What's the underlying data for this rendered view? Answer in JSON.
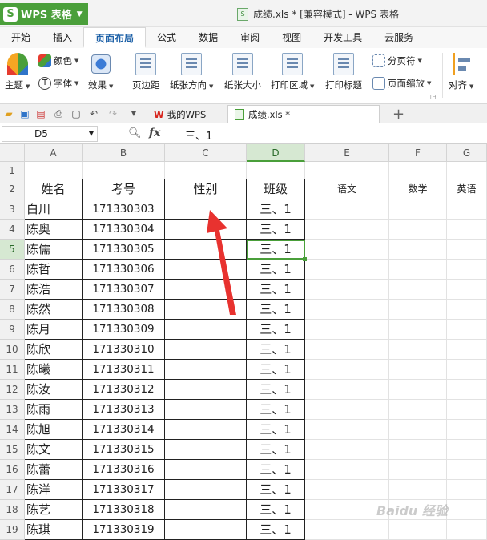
{
  "app": {
    "name": "WPS 表格",
    "logo_glyph": "S",
    "accent": "#4a9f3a"
  },
  "window": {
    "title": "成绩.xls * [兼容模式] - WPS 表格"
  },
  "tabs": [
    {
      "label": "开始"
    },
    {
      "label": "插入"
    },
    {
      "label": "页面布局",
      "active": true
    },
    {
      "label": "公式"
    },
    {
      "label": "数据"
    },
    {
      "label": "审阅"
    },
    {
      "label": "视图"
    },
    {
      "label": "开发工具"
    },
    {
      "label": "云服务"
    }
  ],
  "ribbon": {
    "theme": "主题",
    "color": "颜色",
    "font": "字体",
    "effect": "效果",
    "margins": "页边距",
    "orientation": "纸张方向",
    "size": "纸张大小",
    "print_area": "打印区域",
    "print_titles": "打印标题",
    "page_break": "分页符",
    "page_zoom": "页面缩放",
    "align": "对齐"
  },
  "doc_tabs": {
    "home": "我的WPS",
    "file": "成绩.xls *"
  },
  "formula_bar": {
    "cell_ref": "D5",
    "fx": "fx",
    "value": "三、1"
  },
  "columns": [
    "A",
    "B",
    "C",
    "D",
    "E",
    "F",
    "G"
  ],
  "selected_col": "D",
  "selected_row": 5,
  "header_row": [
    "姓名",
    "考号",
    "性别",
    "班级",
    "语文",
    "数学",
    "英语"
  ],
  "rows": [
    {
      "n": 3,
      "name": "白川",
      "id": "171330303",
      "cls": "三、1"
    },
    {
      "n": 4,
      "name": "陈奥",
      "id": "171330304",
      "cls": "三、1"
    },
    {
      "n": 5,
      "name": "陈儒",
      "id": "171330305",
      "cls": "三、1"
    },
    {
      "n": 6,
      "name": "陈哲",
      "id": "171330306",
      "cls": "三、1"
    },
    {
      "n": 7,
      "name": "陈浩",
      "id": "171330307",
      "cls": "三、1"
    },
    {
      "n": 8,
      "name": "陈然",
      "id": "171330308",
      "cls": "三、1"
    },
    {
      "n": 9,
      "name": "陈月",
      "id": "171330309",
      "cls": "三、1"
    },
    {
      "n": 10,
      "name": "陈欣",
      "id": "171330310",
      "cls": "三、1"
    },
    {
      "n": 11,
      "name": "陈曦",
      "id": "171330311",
      "cls": "三、1"
    },
    {
      "n": 12,
      "name": "陈汝",
      "id": "171330312",
      "cls": "三、1"
    },
    {
      "n": 13,
      "name": "陈雨",
      "id": "171330313",
      "cls": "三、1"
    },
    {
      "n": 14,
      "name": "陈旭",
      "id": "171330314",
      "cls": "三、1"
    },
    {
      "n": 15,
      "name": "陈文",
      "id": "171330315",
      "cls": "三、1"
    },
    {
      "n": 16,
      "name": "陈蕾",
      "id": "171330316",
      "cls": "三、1"
    },
    {
      "n": 17,
      "name": "陈洋",
      "id": "171330317",
      "cls": "三、1"
    },
    {
      "n": 18,
      "name": "陈艺",
      "id": "171330318",
      "cls": "三、1"
    },
    {
      "n": 19,
      "name": "陈琪",
      "id": "171330319",
      "cls": "三、1"
    }
  ],
  "watermark": "Baidu 经验",
  "annotation": {
    "arrow_color": "#e8322f"
  }
}
